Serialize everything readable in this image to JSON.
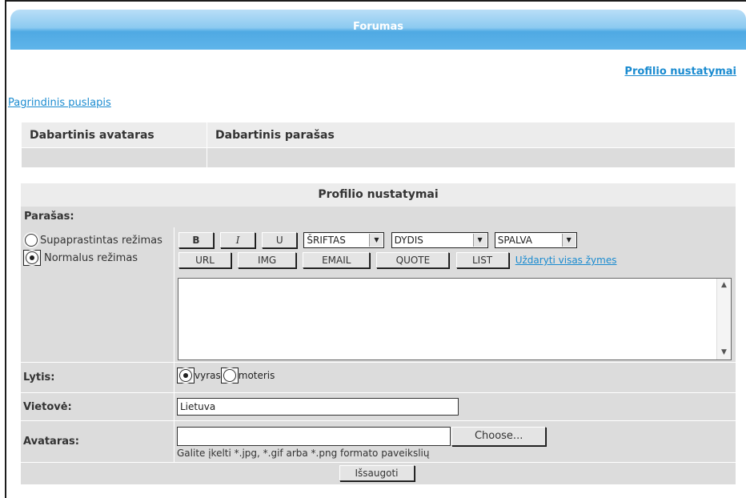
{
  "banner": {
    "title": "Forumas"
  },
  "links": {
    "profile_settings": "Profilio nustatymai",
    "home": "Pagrindinis puslapis"
  },
  "current": {
    "avatar_header": "Dabartinis avataras",
    "signature_header": "Dabartinis parašas"
  },
  "form": {
    "title": "Profilio nustatymai",
    "signature_label": "Parašas:",
    "mode_simple": "Supaprastintas režimas",
    "mode_normal": "Normalus režimas",
    "editor": {
      "bold": "B",
      "italic": "I",
      "underline": "U",
      "font": "ŠRIFTAS",
      "size": "DYDIS",
      "color": "SPALVA",
      "url": "URL",
      "img": "IMG",
      "email": "EMAIL",
      "quote": "QUOTE",
      "list": "LIST",
      "close_tags": "Uždaryti visas žymes"
    },
    "gender_label": "Lytis:",
    "gender_male": "vyras",
    "gender_female": "moteris",
    "location_label": "Vietovė:",
    "location_value": "Lietuva",
    "avatar_label": "Avataras:",
    "choose_button": "Choose...",
    "avatar_hint": "Galite įkelti *.jpg, *.gif arba *.png formato paveikslių",
    "save_button": "Išsaugoti"
  }
}
